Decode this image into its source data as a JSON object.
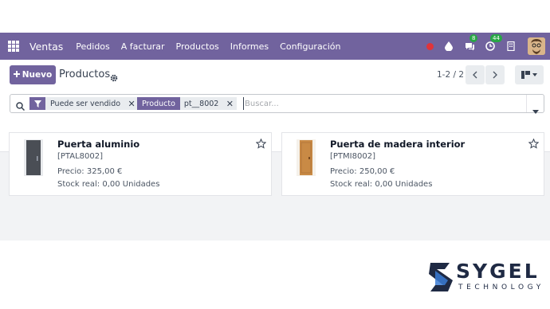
{
  "navbar": {
    "brand": "Ventas",
    "menu": [
      "Pedidos",
      "A facturar",
      "Productos",
      "Informes",
      "Configuración"
    ],
    "messages_count": "8",
    "activities_count": "44",
    "bg_color": "#71639e"
  },
  "control_panel": {
    "new_label": "Nuevo",
    "new_icon": "plus-icon",
    "title": "Productos",
    "pager": "1-2 / 2"
  },
  "search": {
    "facets": [
      {
        "tag_icon": "filter-icon",
        "value": "Puede ser vendido"
      },
      {
        "tag_label": "Producto",
        "value": "pt__8002"
      }
    ],
    "placeholder": "Buscar..."
  },
  "products": [
    {
      "name": "Puerta aluminio",
      "reference": "[PTAL8002]",
      "price": "Precio: 325,00 €",
      "stock": "Stock real: 0,00 Unidades",
      "image": "dark-grey-door",
      "color": "#4a4e55"
    },
    {
      "name": "Puerta de madera interior",
      "reference": "[PTMI8002]",
      "price": "Precio: 250,00 €",
      "stock": "Stock real: 0,00 Unidades",
      "image": "wooden-door",
      "color": "#c98a45"
    }
  ],
  "watermark": {
    "brand": "SYGEL",
    "sub": "TECHNOLOGY",
    "color": "#1f2a44"
  }
}
